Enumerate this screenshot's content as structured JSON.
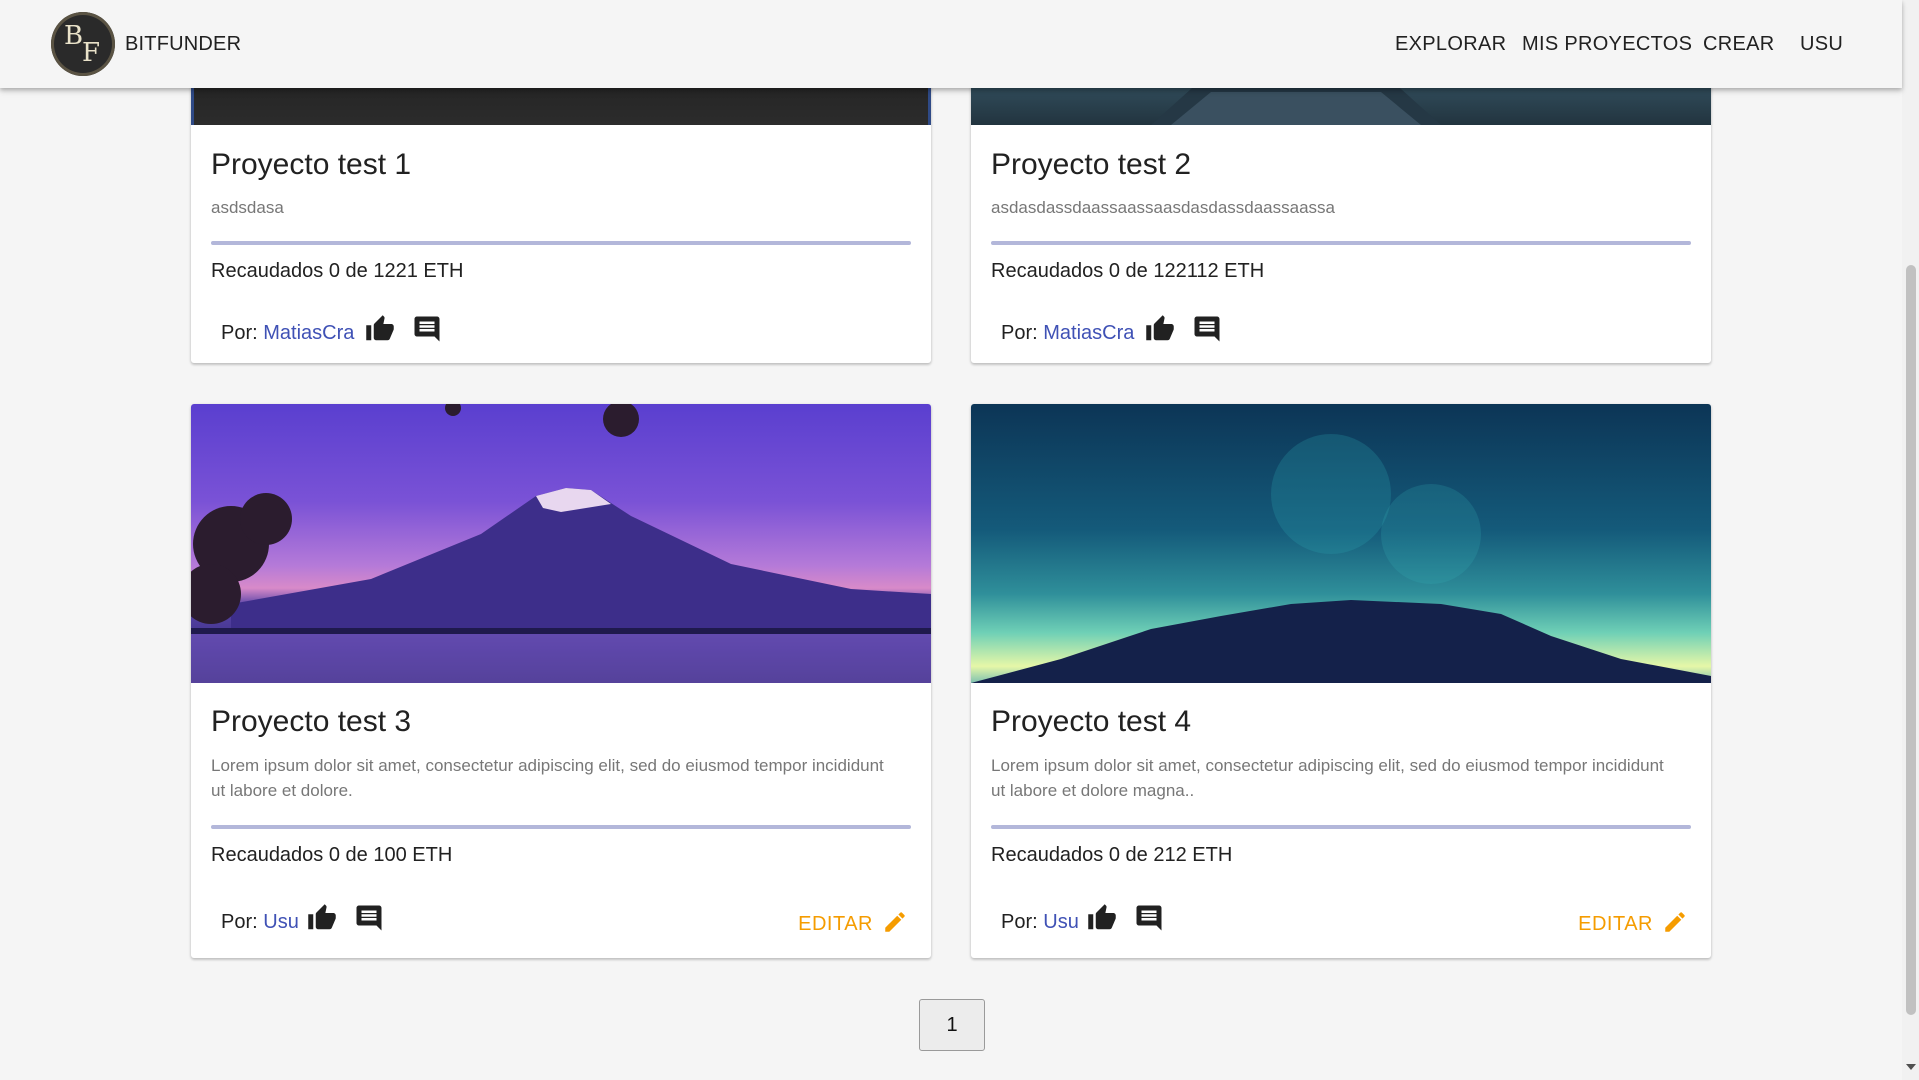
{
  "header": {
    "logo_letters": [
      "B",
      "F"
    ],
    "brand": "BITFUNDER",
    "nav": [
      "EXPLORAR",
      "MIS PROYECTOS",
      "CREAR",
      "USU"
    ]
  },
  "projects": [
    {
      "title": "Proyecto test 1",
      "description": "asdsdasa",
      "raised_text": "Recaudados 0 de 1221 ETH",
      "progress": 0,
      "author_prefix": "Por:",
      "author": "MatiasCra",
      "editable": false
    },
    {
      "title": "Proyecto test 2",
      "description": "asdasdassdaassaassaasdasdassdaassaassa",
      "raised_text": "Recaudados 0 de 122112 ETH",
      "progress": 0,
      "author_prefix": "Por:",
      "author": "MatiasCra",
      "editable": false
    },
    {
      "title": "Proyecto test 3",
      "description": "Lorem ipsum dolor sit amet, consectetur adipiscing elit, sed do eiusmod tempor incididunt ut labore et dolore.",
      "raised_text": "Recaudados 0 de 100 ETH",
      "progress": 0,
      "author_prefix": "Por:",
      "author": "Usu",
      "editable": true,
      "edit_label": "EDITAR"
    },
    {
      "title": "Proyecto test 4",
      "description": "Lorem ipsum dolor sit amet, consectetur adipiscing elit, sed do eiusmod tempor incididunt ut labore et dolore magna..",
      "raised_text": "Recaudados 0 de 212 ETH",
      "progress": 0,
      "author_prefix": "Por:",
      "author": "Usu",
      "editable": true,
      "edit_label": "EDITAR"
    }
  ],
  "icons": [
    "thumb-up-icon",
    "comment-icon",
    "pencil-icon"
  ],
  "pagination": {
    "current": "1"
  },
  "colors": {
    "link": "#3f51b5",
    "edit": "#f59c00",
    "progress_track": "#b3b7da"
  }
}
